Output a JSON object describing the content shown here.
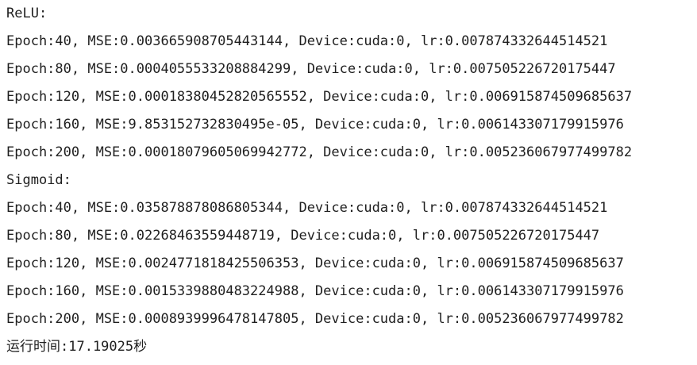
{
  "output": {
    "lines": [
      "ReLU:",
      "Epoch:40, MSE:0.003665908705443144, Device:cuda:0, lr:0.007874332644514521",
      "Epoch:80, MSE:0.0004055533208884299, Device:cuda:0, lr:0.007505226720175447",
      "Epoch:120, MSE:0.00018380452820565552, Device:cuda:0, lr:0.006915874509685637",
      "Epoch:160, MSE:9.853152732830495e-05, Device:cuda:0, lr:0.006143307179915976",
      "Epoch:200, MSE:0.00018079605069942772, Device:cuda:0, lr:0.005236067977499782",
      "Sigmoid:",
      "Epoch:40, MSE:0.035878878086805344, Device:cuda:0, lr:0.007874332644514521",
      "Epoch:80, MSE:0.02268463559448719, Device:cuda:0, lr:0.007505226720175447",
      "Epoch:120, MSE:0.0024771818425506353, Device:cuda:0, lr:0.006915874509685637",
      "Epoch:160, MSE:0.0015339880483224988, Device:cuda:0, lr:0.006143307179915976",
      "Epoch:200, MSE:0.0008939996478147805, Device:cuda:0, lr:0.005236067977499782",
      "运行时间:17.19025秒"
    ]
  }
}
